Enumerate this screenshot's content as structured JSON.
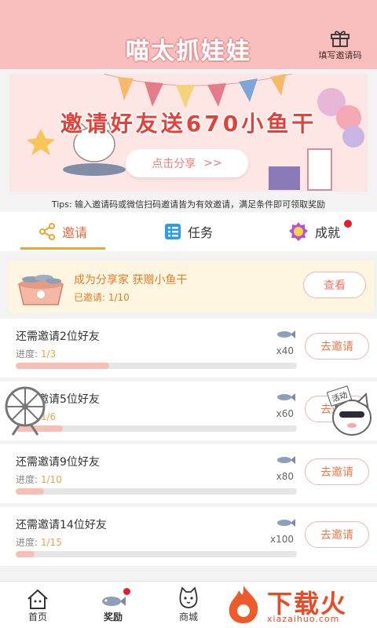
{
  "header": {
    "title": "喵太抓娃娃",
    "invite_code_label": "填写邀请码"
  },
  "banner": {
    "title": "邀请好友送670小鱼干",
    "share_label": "点击分享",
    "share_arrow": ">>"
  },
  "tips": "Tips: 输入邀请码或微信扫码邀请皆为有效邀请，满足条件即可领取奖励",
  "tabs": [
    {
      "label": "邀请",
      "icon": "share-icon"
    },
    {
      "label": "任务",
      "icon": "list-icon"
    },
    {
      "label": "成就",
      "icon": "medal-icon"
    }
  ],
  "achievement": {
    "title": "成为分享家 获赠小鱼干",
    "invited_label": "已邀请: 1/10",
    "view_label": "查看"
  },
  "tasks": [
    {
      "title": "还需邀请2位好友",
      "progress_label": "进度:",
      "progress_value": "1/3",
      "reward": "x40",
      "fill": 0.333,
      "button": "去邀请"
    },
    {
      "title": "还需邀请5位好友",
      "progress_label": "进度:",
      "progress_value": "1/6",
      "reward": "x60",
      "fill": 0.167,
      "button": "去邀请"
    },
    {
      "title": "还需邀请9位好友",
      "progress_label": "进度:",
      "progress_value": "1/10",
      "reward": "x80",
      "fill": 0.1,
      "button": "去邀请"
    },
    {
      "title": "还需邀请14位好友",
      "progress_label": "进度:",
      "progress_value": "1/15",
      "reward": "x100",
      "fill": 0.067,
      "button": "去邀请"
    }
  ],
  "float_badge": "活动",
  "nav": [
    {
      "label": "首页",
      "icon": "home-icon"
    },
    {
      "label": "奖励",
      "icon": "fish-icon"
    },
    {
      "label": "商城",
      "icon": "cat-icon"
    }
  ],
  "watermark": {
    "text": "下载火",
    "sub": "xiazaihuo.com"
  },
  "colors": {
    "header_bg": "#f9bfbf",
    "accent": "#e46b3e",
    "button_border": "#f0b7aa",
    "progress_fill": "#f7bfb6",
    "badge_red": "#e51d2a"
  }
}
